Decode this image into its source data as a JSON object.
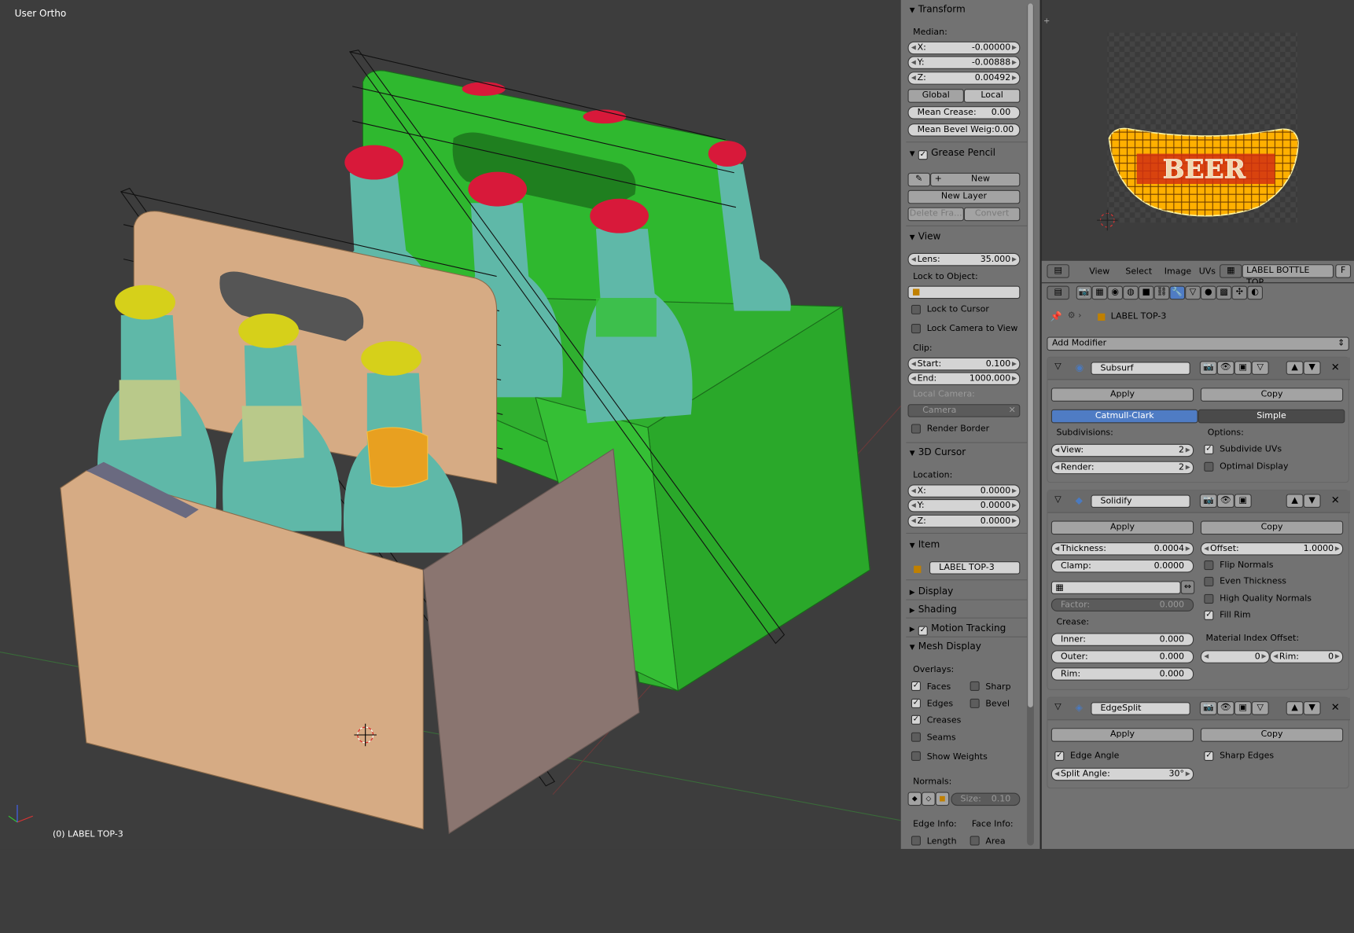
{
  "viewport": {
    "view_label": "User Ortho",
    "object_label": "(0) LABEL TOP-3"
  },
  "npanel": {
    "transform": {
      "title": "Transform",
      "median_label": "Median:",
      "x_label": "X:",
      "x": "-0.00000",
      "y_label": "Y:",
      "y": "-0.00888",
      "z_label": "Z:",
      "z": "0.00492",
      "global": "Global",
      "local": "Local",
      "mean_crease_label": "Mean Crease:",
      "mean_crease": "0.00",
      "mean_bevel_label": "Mean Bevel Weig:",
      "mean_bevel": "0.00"
    },
    "grease": {
      "title": "Grease Pencil",
      "new": "New",
      "new_layer": "New Layer",
      "delete_frame": "Delete Fra...",
      "convert": "Convert"
    },
    "view": {
      "title": "View",
      "lens_label": "Lens:",
      "lens": "35.000",
      "lock_object": "Lock to Object:",
      "lock_cursor": "Lock to Cursor",
      "lock_camera": "Lock Camera to View",
      "clip": "Clip:",
      "start_label": "Start:",
      "start": "0.100",
      "end_label": "End:",
      "end": "1000.000",
      "local_camera": "Local Camera:",
      "camera": "Camera",
      "render_border": "Render Border"
    },
    "cursor": {
      "title": "3D Cursor",
      "location": "Location:",
      "x_label": "X:",
      "x": "0.0000",
      "y_label": "Y:",
      "y": "0.0000",
      "z_label": "Z:",
      "z": "0.0000"
    },
    "item": {
      "title": "Item",
      "name": "LABEL TOP-3"
    },
    "display": {
      "title": "Display"
    },
    "shading": {
      "title": "Shading"
    },
    "motion": {
      "title": "Motion Tracking"
    },
    "mesh": {
      "title": "Mesh Display",
      "overlays": "Overlays:",
      "faces": "Faces",
      "sharp": "Sharp",
      "edges": "Edges",
      "bevel": "Bevel",
      "creases": "Creases",
      "seams": "Seams",
      "show_weights": "Show Weights",
      "normals": "Normals:",
      "size_label": "Size:",
      "size": "0.10",
      "edge_info": "Edge Info:",
      "face_info": "Face Info:",
      "length": "Length",
      "area": "Area"
    }
  },
  "uv": {
    "header": {
      "view": "View",
      "select": "Select",
      "image": "Image",
      "uvs": "UVs",
      "image_name": "LABEL BOTTLE TOP...",
      "f": "F"
    }
  },
  "props": {
    "object_name": "LABEL TOP-3",
    "add_modifier": "Add Modifier",
    "subsurf": {
      "name": "Subsurf",
      "apply": "Apply",
      "copy": "Copy",
      "catmull": "Catmull-Clark",
      "simple": "Simple",
      "subdivisions": "Subdivisions:",
      "options": "Options:",
      "view_label": "View:",
      "view": "2",
      "render_label": "Render:",
      "render": "2",
      "subdivide_uvs": "Subdivide UVs",
      "optimal": "Optimal Display"
    },
    "solidify": {
      "name": "Solidify",
      "apply": "Apply",
      "copy": "Copy",
      "thickness_label": "Thickness:",
      "thickness": "0.0004",
      "offset_label": "Offset:",
      "offset": "1.0000",
      "clamp_label": "Clamp:",
      "clamp": "0.0000",
      "flip": "Flip Normals",
      "even": "Even Thickness",
      "hq": "High Quality Normals",
      "fill_rim": "Fill Rim",
      "factor_label": "Factor:",
      "factor": "0.000",
      "crease": "Crease:",
      "inner_label": "Inner:",
      "inner": "0.000",
      "outer_label": "Outer:",
      "outer": "0.000",
      "rim_label": "Rim:",
      "rim": "0.000",
      "mat_offset": "Material Index Offset:",
      "mat_val": "0",
      "rim2_label": "Rim:",
      "rim2": "0"
    },
    "edgesplit": {
      "name": "EdgeSplit",
      "apply": "Apply",
      "copy": "Copy",
      "edge_angle": "Edge Angle",
      "sharp_edges": "Sharp Edges",
      "split_label": "Split Angle:",
      "split": "30°"
    }
  },
  "colors": {
    "green": "#2db52d",
    "tan": "#d4a983",
    "bottle": "#5fb4a8",
    "red": "#d81b35",
    "yellow": "#d6d01a",
    "uv_orange": "#ffb000"
  }
}
